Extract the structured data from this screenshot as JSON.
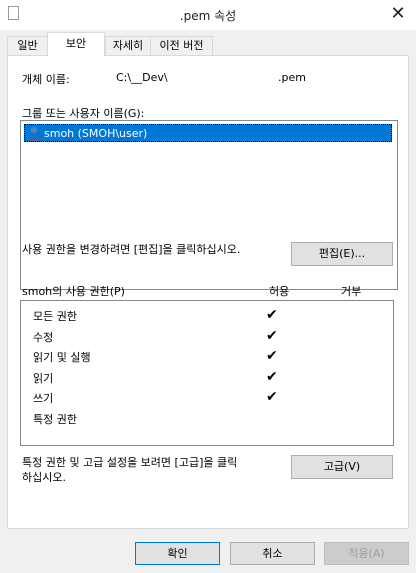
{
  "window": {
    "title": ".pem 속성",
    "close_glyph": "✕"
  },
  "tabs": [
    {
      "label": "일반",
      "active": false
    },
    {
      "label": "보안",
      "active": true
    },
    {
      "label": "자세히",
      "active": false
    },
    {
      "label": "이전 버전",
      "active": false
    }
  ],
  "object": {
    "label": "개체 이름:",
    "path": "C:\\__Dev\\",
    "extension": ".pem"
  },
  "groups": {
    "label": "그룹 또는 사용자 이름(G):",
    "items": [
      {
        "name": "smoh (SMOH\\user)",
        "selected": true,
        "icon": "user-icon"
      }
    ]
  },
  "edit": {
    "hint": "사용 권한을 변경하려면 [편집]을 클릭하십시오.",
    "button_label": "편집(E)..."
  },
  "permissions": {
    "title": "smoh의 사용 권한(P)",
    "allow_header": "허용",
    "deny_header": "거부",
    "check_glyph": "✔",
    "rows": [
      {
        "name": "모든 권한",
        "allow": true,
        "deny": false
      },
      {
        "name": "수정",
        "allow": true,
        "deny": false
      },
      {
        "name": "읽기 및 실행",
        "allow": true,
        "deny": false
      },
      {
        "name": "읽기",
        "allow": true,
        "deny": false
      },
      {
        "name": "쓰기",
        "allow": true,
        "deny": false
      },
      {
        "name": "특정 권한",
        "allow": false,
        "deny": false
      }
    ]
  },
  "advanced": {
    "hint_line1": "특정 권한 및 고급 설정을 보려면 [고급]을 클릭",
    "hint_line2": "하십시오.",
    "button_label": "고급(V)"
  },
  "footer": {
    "ok_label": "확인",
    "cancel_label": "취소",
    "apply_label": "적용(A)"
  },
  "colors": {
    "selection": "#0078d7",
    "focus_border": "#0078d7",
    "button_face": "#e1e1e1"
  }
}
